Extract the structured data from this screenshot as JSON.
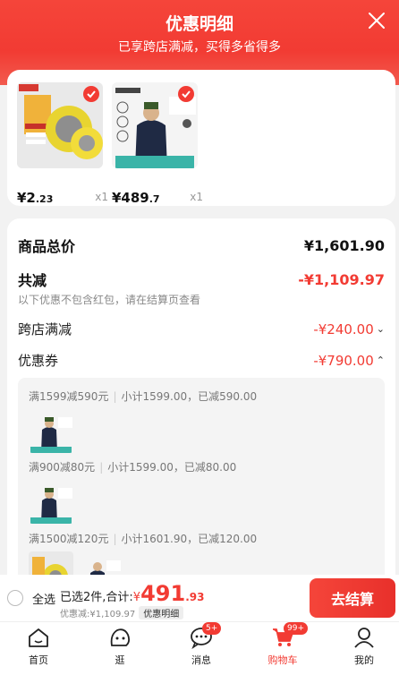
{
  "header": {
    "title": "优惠明细",
    "subtitle": "已享跨店满减，买得多省得多"
  },
  "products": [
    {
      "price_int": "¥2",
      "price_dec": ".23",
      "qty": "x1",
      "image": "tape-rolls"
    },
    {
      "price_int": "¥489",
      "price_dec": ".7",
      "qty": "x1",
      "image": "timberland-jacket"
    }
  ],
  "summary": {
    "total_label": "商品总价",
    "total_value": "¥1,601.90",
    "reduce_label": "共减",
    "reduce_value": "-¥1,109.97",
    "note": "以下优惠不包含红包，请在结算页查看",
    "cross_label": "跨店满减",
    "cross_value": "-¥240.00",
    "coupon_label": "优惠券",
    "coupon_value": "-¥790.00"
  },
  "coupons": [
    {
      "rule": "满1599减590元",
      "subtotal": "小计1599.00，已减590.00"
    },
    {
      "rule": "满900减80元",
      "subtotal": "小计1599.00，已减80.00"
    },
    {
      "rule": "满1500减120元",
      "subtotal": "小计1601.90，已减120.00"
    }
  ],
  "checkout": {
    "select_all": "全选",
    "selected": "已选2件,合计:",
    "yen": "¥",
    "amount_int": "491",
    "amount_dec": ".93",
    "discount": "优惠减:¥1,109.97",
    "detail_tag": "优惠明细",
    "button": "去结算"
  },
  "nav": [
    {
      "label": "首页",
      "icon": "home-icon"
    },
    {
      "label": "逛",
      "icon": "face-icon"
    },
    {
      "label": "消息",
      "icon": "message-icon",
      "badge": "5+"
    },
    {
      "label": "购物车",
      "icon": "cart-icon",
      "badge": "99+",
      "active": true
    },
    {
      "label": "我的",
      "icon": "profile-icon"
    }
  ],
  "colors": {
    "accent": "#f23b33"
  }
}
